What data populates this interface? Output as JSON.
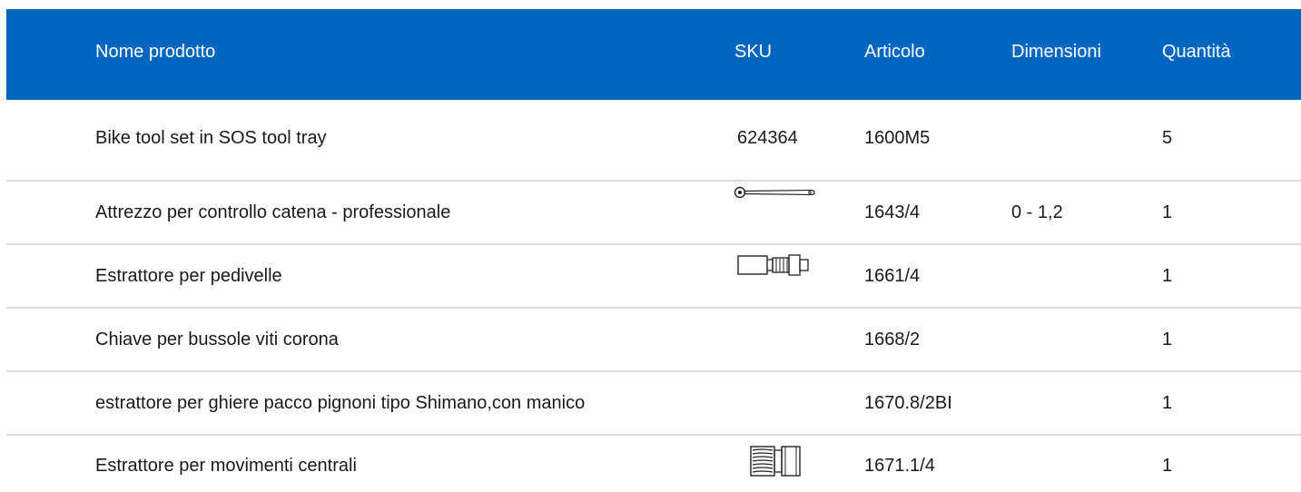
{
  "table": {
    "headers": {
      "name": "Nome prodotto",
      "sku": "SKU",
      "article": "Articolo",
      "dimensions": "Dimensioni",
      "quantity": "Quantità"
    },
    "rows": [
      {
        "name": "Bike tool set in SOS tool tray",
        "sku": "624364",
        "article": "1600M5",
        "dimensions": "",
        "quantity": "5",
        "thumbnail": ""
      },
      {
        "name": "Attrezzo per controllo catena - professionale",
        "sku": "",
        "article": "1643/4",
        "dimensions": "0 - 1,2",
        "quantity": "1",
        "thumbnail": "chain-checker-icon"
      },
      {
        "name": "Estrattore per pedivelle",
        "sku": "",
        "article": "1661/4",
        "dimensions": "",
        "quantity": "1",
        "thumbnail": "crank-puller-icon"
      },
      {
        "name": "Chiave per bussole viti corona",
        "sku": "",
        "article": "1668/2",
        "dimensions": "",
        "quantity": "1",
        "thumbnail": ""
      },
      {
        "name": "estrattore per ghiere pacco pignoni tipo Shimano,con manico",
        "sku": "",
        "article": "1670.8/2BI",
        "dimensions": "",
        "quantity": "1",
        "thumbnail": ""
      },
      {
        "name": "Estrattore per movimenti centrali",
        "sku": "",
        "article": "1671.1/4",
        "dimensions": "",
        "quantity": "1",
        "thumbnail": "bottom-bracket-tool-icon"
      }
    ]
  },
  "colors": {
    "header_bg": "#0066c0",
    "header_text": "#ffffff",
    "divider": "#dcdcdc"
  }
}
